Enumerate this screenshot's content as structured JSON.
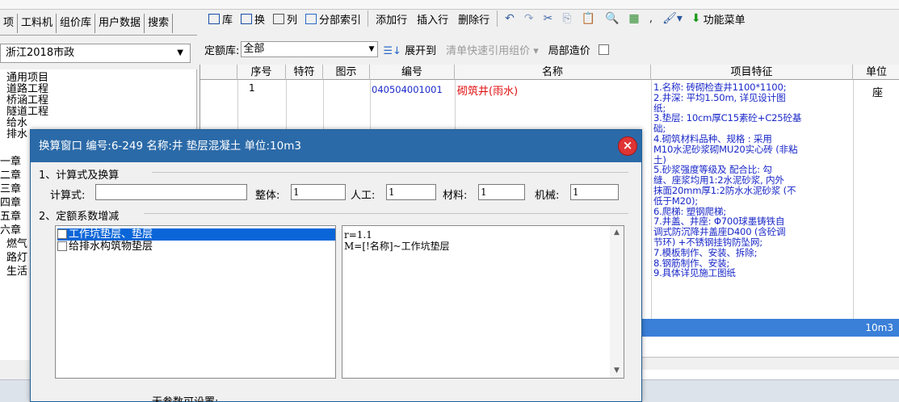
{
  "left_tabs": [
    "项",
    "工料机",
    "组价库",
    "用户数据",
    "搜索"
  ],
  "library_select": "浙江2018市政",
  "tree": [
    "通用项目",
    "道路工程",
    "桥涵工程",
    "隧道工程",
    "给水",
    "排水",
    "一章",
    "二章",
    "三章",
    "四章",
    "五章",
    "六章",
    "燃气",
    "路灯",
    "生活"
  ],
  "toolbar": {
    "lib": "库",
    "swap": "换",
    "col": "列",
    "index": "分部索引",
    "add_row": "添加行",
    "insert_row": "插入行",
    "delete_row": "删除行",
    "function_menu": "功能菜单"
  },
  "filter": {
    "quota_label": "定额库:",
    "quota_value": "全部",
    "expand": "展开到",
    "clear_ref": "清单快速引用组价",
    "local_cost": "局部造价"
  },
  "grid": {
    "headers": [
      "序号",
      "特符",
      "图示",
      "编号",
      "名称",
      "项目特征",
      "单位"
    ],
    "row": {
      "seq": "1",
      "code": "040504001001",
      "name": "砌筑井(雨水)",
      "unit": "座",
      "feature": "1.名称: 砖砌检查井1100*1100;\n2.井深: 平均1.50m, 详见设计图\n纸;\n3.垫层: 10cm厚C15素砼+C25砼基\n础;\n4.砌筑材料品种、规格 : 采用\nM10水泥砂浆砌MU20实心砖 (非粘\n土)\n5.砂浆强度等级及 配合比: 勾\n缝、座浆均用1:2水泥砂浆, 内外\n抹面20mm厚1:2防水水泥砂浆 (不\n低于M20);\n6.爬梯: 塑钢爬梯;\n7.井盖、井座: Φ700球墨铸铁自\n调式防沉降井盖座D400 (含砼调\n节环) +不锈钢挂钩防坠网;\n7.模板制作、安装、拆除;\n8.钢筋制作、安装;\n9.具体详见施工图纸"
    },
    "selected_unit": "10m3"
  },
  "dialog": {
    "title": "换算窗口 编号:6-249 名称:井 垫层混凝土 单位:10m3",
    "section1": "1、计算式及换算",
    "calc_label": "计算式:",
    "whole_label": "整体:",
    "whole_value": "1",
    "labor_label": "人工:",
    "labor_value": "1",
    "material_label": "材料:",
    "material_value": "1",
    "machine_label": "机械:",
    "machine_value": "1",
    "section2": "2、定额系数增减",
    "factors": [
      "工作坑垫层、垫层",
      "给排水构筑物垫层"
    ],
    "formula": "r=1.1\nM=[!名称]~工作坑垫层",
    "no_param": "无参数可设置:",
    "close": "×"
  },
  "colors": {
    "title_bar": "#2b6aa8",
    "selection": "#0a66d8",
    "feature_text": "#1a28c8",
    "name_red": "#e01010",
    "code_blue": "#1a28c8"
  }
}
